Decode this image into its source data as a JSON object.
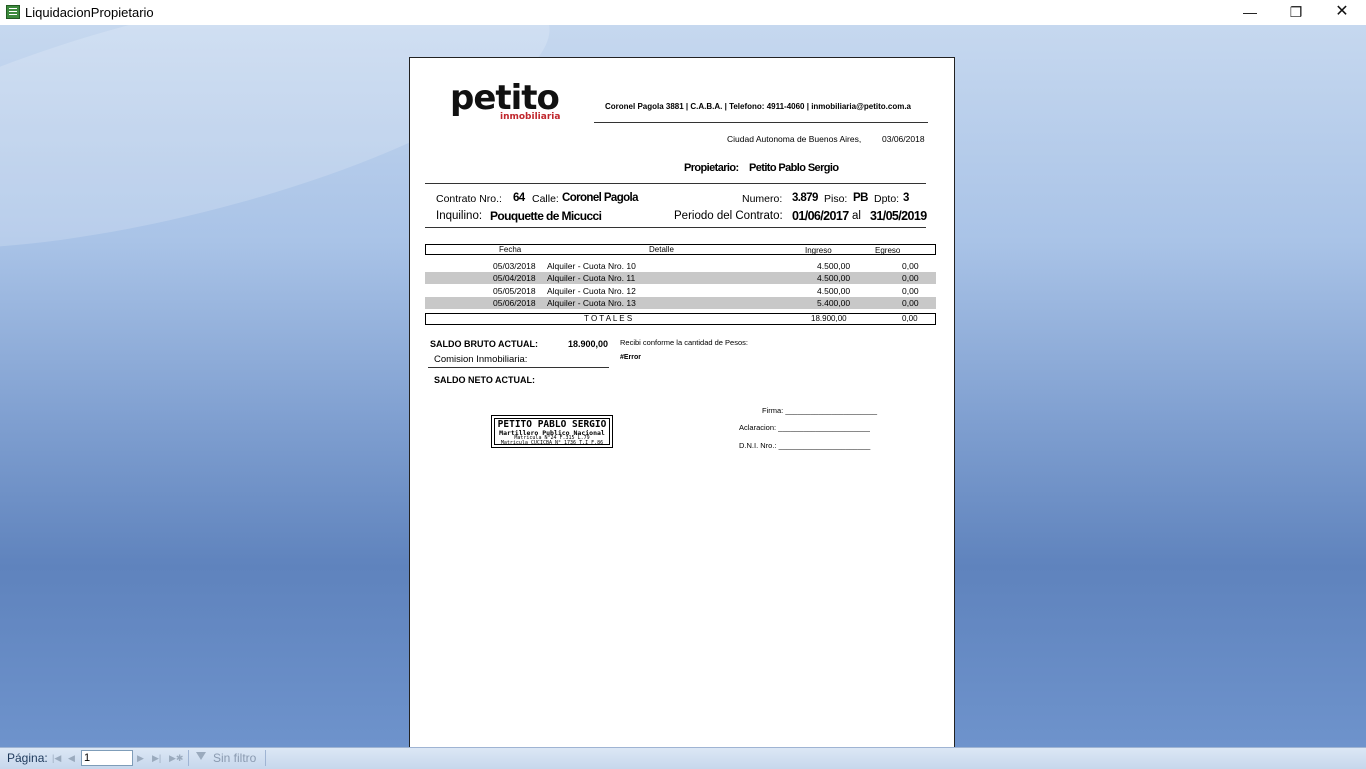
{
  "window": {
    "title": "LiquidacionPropietario",
    "minimize": "—",
    "maximize": "❐",
    "close": "✕"
  },
  "report": {
    "logo": {
      "main": "petito",
      "sub": "inmobiliaria"
    },
    "header_contact": "Coronel Pagola 3881 | C.A.B.A. | Telefono: 4911-4060 | inmobiliaria@petito.com.a",
    "place_date": {
      "place": "Ciudad Autonoma de Buenos Aires,",
      "date": "03/06/2018"
    },
    "owner": {
      "label": "Propietario:",
      "value": "Petito Pablo Sergio"
    },
    "contract": {
      "nro_label": "Contrato Nro.:",
      "nro": "64",
      "calle_label": "Calle:",
      "calle": "Coronel Pagola",
      "numero_label": "Numero:",
      "numero": "3.879",
      "piso_label": "Piso:",
      "piso": "PB",
      "dpto_label": "Dpto:",
      "dpto": "3",
      "inquilino_label": "Inquilino:",
      "inquilino": "Pouquette de Micucci",
      "periodo_label": "Periodo del Contrato:",
      "desde": "01/06/2017",
      "al": "al",
      "hasta": "31/05/2019"
    },
    "table": {
      "headers": {
        "fecha": "Fecha",
        "detalle": "Detalle",
        "ingreso": "Ingreso",
        "egreso": "Egreso"
      },
      "rows": [
        {
          "fecha": "05/03/2018",
          "detalle": "Alquiler - Cuota Nro. 10",
          "ingreso": "4.500,00",
          "egreso": "0,00"
        },
        {
          "fecha": "05/04/2018",
          "detalle": "Alquiler - Cuota Nro. 11",
          "ingreso": "4.500,00",
          "egreso": "0,00"
        },
        {
          "fecha": "05/05/2018",
          "detalle": "Alquiler - Cuota Nro. 12",
          "ingreso": "4.500,00",
          "egreso": "0,00"
        },
        {
          "fecha": "05/06/2018",
          "detalle": "Alquiler - Cuota Nro. 13",
          "ingreso": "5.400,00",
          "egreso": "0,00"
        }
      ],
      "totals": {
        "label": "T O T A L E S",
        "ingreso": "18.900,00",
        "egreso": "0,00"
      }
    },
    "saldo": {
      "bruto_label": "SALDO BRUTO ACTUAL:",
      "bruto": "18.900,00",
      "comision_label": "Comision Inmobiliaria:",
      "neto_label": "SALDO NETO ACTUAL:"
    },
    "recibi": {
      "text": "Recibi conforme la cantidad de Pesos:",
      "value": "#Error"
    },
    "stamp": {
      "line1": "PETITO PABLO SERGIO",
      "line2": "Martillero Publico Nacional",
      "line3": "Matricula N°24 F.315 L.79",
      "line4": "Matricula CUCICBA N° 1736 T.I F.86"
    },
    "signature": {
      "firma": "Firma: ______________________",
      "aclaracion": "Aclaracion: ______________________",
      "dni": "D.N.I. Nro.: ______________________"
    }
  },
  "statusbar": {
    "pagina_label": "Página:",
    "page_value": "1",
    "filter_label": "Sin filtro",
    "icons": [
      "first-page-icon",
      "prev-page-icon",
      "next-page-icon",
      "last-page-icon",
      "new-record-icon",
      "filter-icon"
    ]
  }
}
